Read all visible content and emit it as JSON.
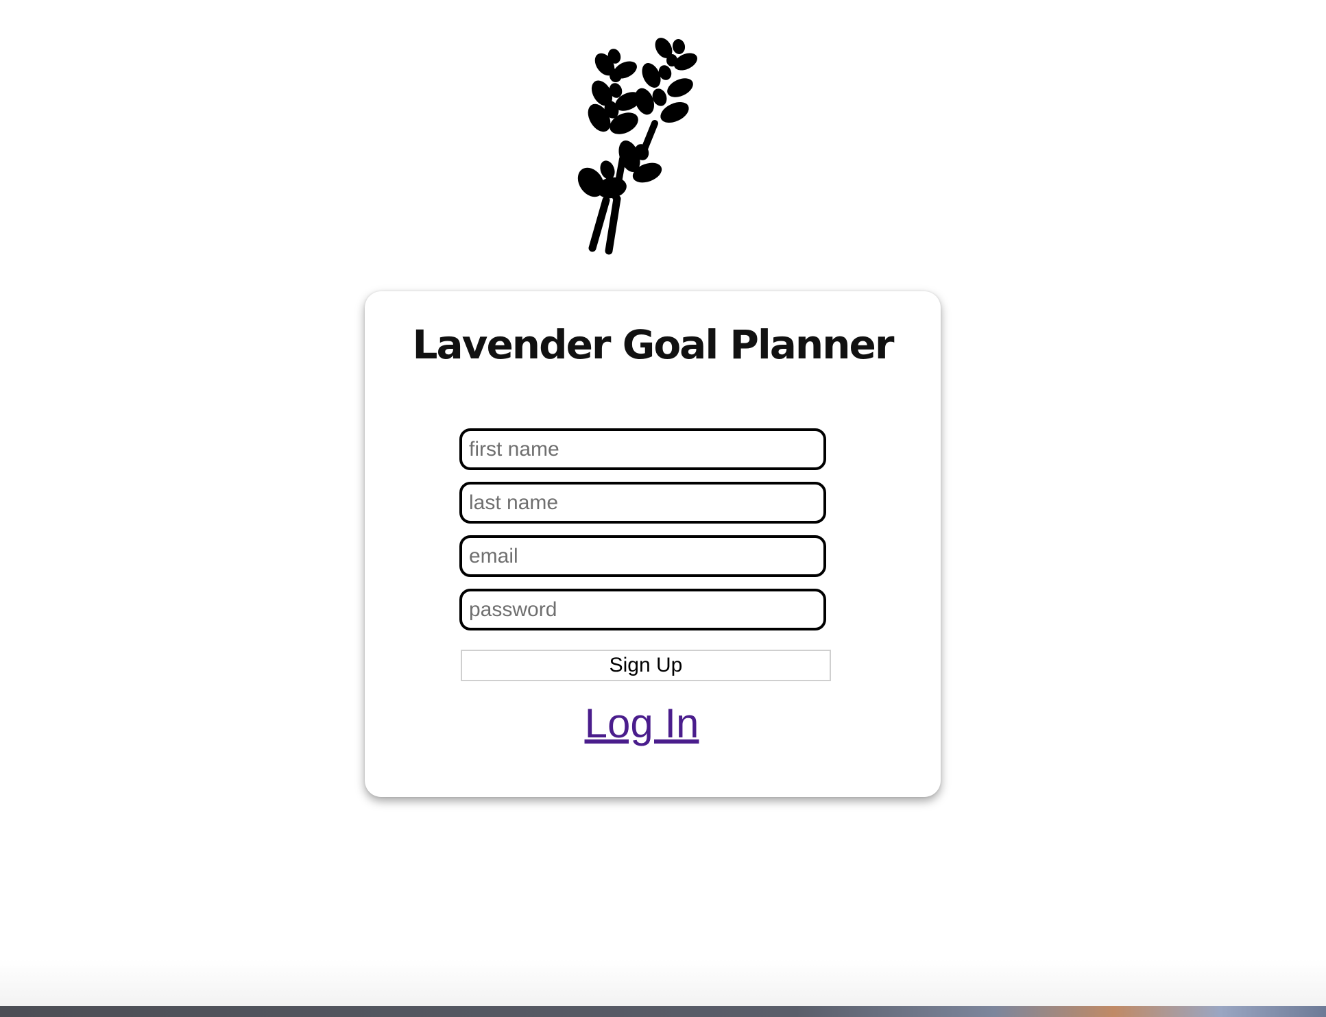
{
  "logo": {
    "icon": "lavender-icon"
  },
  "card": {
    "title": "Lavender Goal Planner",
    "fields": {
      "first_name": {
        "placeholder": "first name",
        "value": ""
      },
      "last_name": {
        "placeholder": "last name",
        "value": ""
      },
      "email": {
        "placeholder": "email",
        "value": ""
      },
      "password": {
        "placeholder": "password",
        "value": ""
      }
    },
    "signup_label": "Sign Up",
    "login_label": "Log In"
  },
  "colors": {
    "link": "#4a1d8c",
    "field_border": "#000000",
    "text": "#111111"
  }
}
